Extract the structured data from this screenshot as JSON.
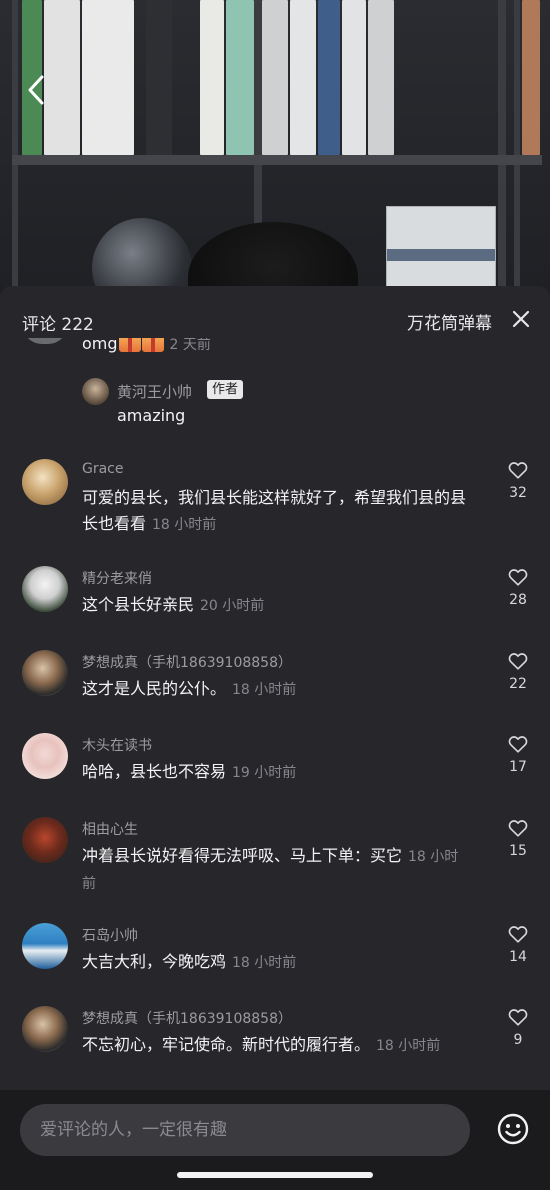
{
  "header": {
    "comment_count_label": "评论 222",
    "kaleidoscope_label": "万花筒弹幕"
  },
  "partial_comment": {
    "text": "omg",
    "time": "2 天前"
  },
  "reply": {
    "name": "黄河王小帅",
    "tag": "作者",
    "text": "amazing"
  },
  "comments": [
    {
      "name": "Grace",
      "text": "可爱的县长，我们县长能这样就好了，希望我们县的县长也看看",
      "time": "18 小时前",
      "likes": "32"
    },
    {
      "name": "精分老来俏",
      "text": "这个县长好亲民",
      "time": "20 小时前",
      "likes": "28"
    },
    {
      "name": "梦想成真（手机18639108858）",
      "text": "这才是人民的公仆。",
      "time": "18 小时前",
      "likes": "22"
    },
    {
      "name": "木头在读书",
      "text": "哈哈，县长也不容易",
      "time": "19 小时前",
      "likes": "17"
    },
    {
      "name": "相由心生",
      "text": "冲着县长说好看得无法呼吸、马上下单：买它",
      "time": "18 小时前",
      "likes": "15"
    },
    {
      "name": "石岛小帅",
      "text": "大吉大利，今晚吃鸡",
      "time": "18 小时前",
      "likes": "14"
    },
    {
      "name": "梦想成真（手机18639108858）",
      "text": "不忘初心，牢记使命。新时代的履行者。",
      "time": "18 小时前",
      "likes": "9"
    }
  ],
  "input": {
    "placeholder": "爱评论的人，一定很有趣"
  },
  "icons": [
    "back-icon",
    "close-icon",
    "heart-icon",
    "emoji-icon",
    "gift-icon"
  ],
  "colors": {
    "sheet_bg": "#27272b",
    "text_primary": "#f3f3f5",
    "text_secondary": "#9b9ba0",
    "time": "#86868c"
  }
}
